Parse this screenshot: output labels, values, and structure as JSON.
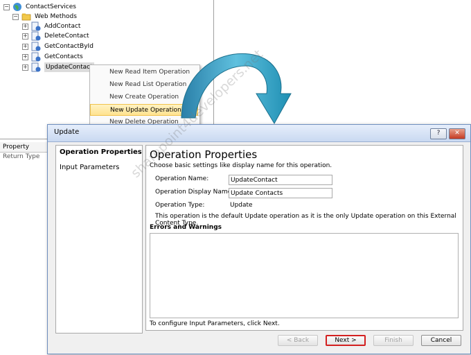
{
  "tree": {
    "root": "ContactServices",
    "folder": "Web Methods",
    "methods": [
      "AddContact",
      "DeleteContact",
      "GetContactById",
      "GetContacts",
      "UpdateContact"
    ]
  },
  "property_strip": {
    "header": "Property",
    "row": "Return Type"
  },
  "context_menu": {
    "items": [
      "New Read Item Operation",
      "New Read List Operation",
      "New Create Operation",
      "New Update Operation",
      "New Delete Operation"
    ],
    "highlighted_index": 3
  },
  "dialog": {
    "title": "Update",
    "help_glyph": "?",
    "close_glyph": "✕",
    "nav": {
      "operation_properties": "Operation Properties",
      "input_parameters": "Input Parameters"
    },
    "heading": "Operation Properties",
    "description": "Choose basic settings like display name for this operation.",
    "operation_name_label": "Operation Name:",
    "operation_name_value": "UpdateContact",
    "display_name_label": "Operation Display Name:",
    "display_name_value": "Update Contacts",
    "type_label": "Operation Type:",
    "type_value": "Update",
    "note": "This operation is the default Update operation as it is the only Update operation on this External Content Type.",
    "errors_heading": "Errors and Warnings",
    "footer_note": "To configure Input Parameters, click Next.",
    "buttons": {
      "back": "< Back",
      "next": "Next >",
      "finish": "Finish",
      "cancel": "Cancel"
    }
  },
  "watermark": "sharepoint4developers.net",
  "colors": {
    "arrow": "#1f8fb3",
    "highlight": "#ffe28f",
    "next_border": "#d32020"
  }
}
